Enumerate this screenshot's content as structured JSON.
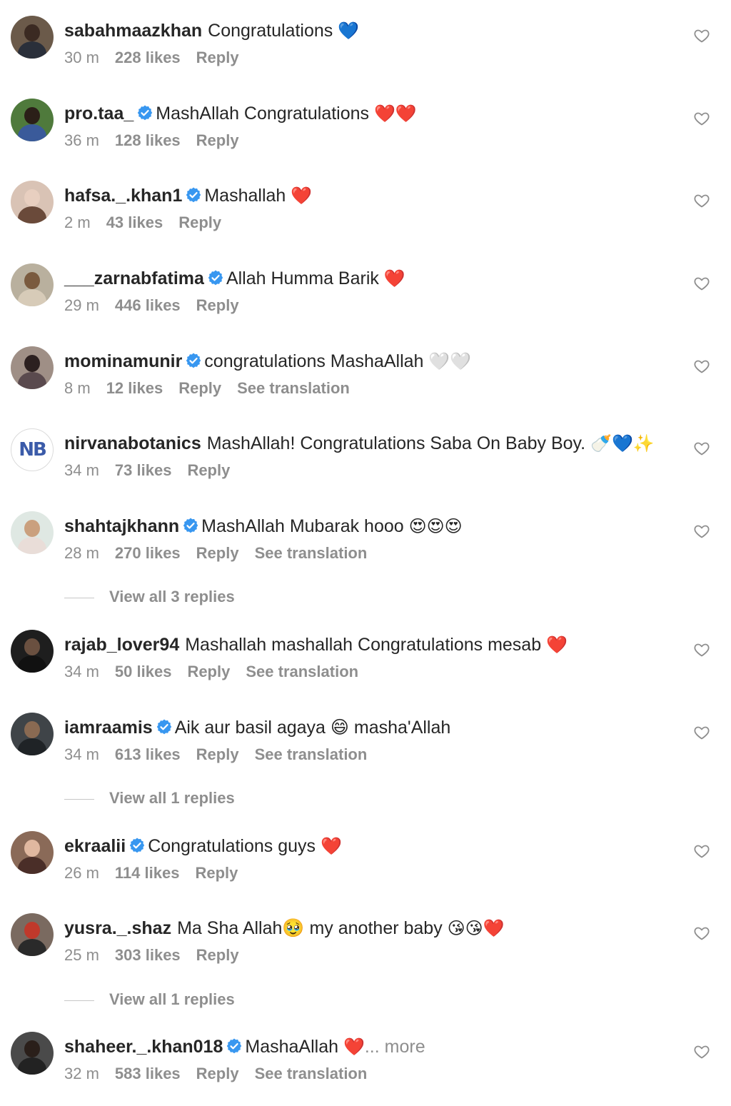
{
  "colors": {
    "text": "#262626",
    "secondary": "#8e8e8e",
    "verified": "#3897f0",
    "heart_outline": "#8e8e8e"
  },
  "comments": [
    {
      "username": "sabahmaazkhan",
      "verified": false,
      "text": "Congratulations",
      "emoji": "💙",
      "time": "30 m",
      "likes": "228 likes",
      "reply": "Reply",
      "translation": "",
      "more": ""
    },
    {
      "username": "pro.taa_",
      "verified": true,
      "text": "MashAllah Congratulations",
      "emoji": "❤️❤️",
      "time": "36 m",
      "likes": "128 likes",
      "reply": "Reply",
      "translation": "",
      "more": ""
    },
    {
      "username": "hafsa._.khan1",
      "verified": true,
      "text": "Mashallah",
      "emoji": "❤️",
      "time": "2 m",
      "likes": "43 likes",
      "reply": "Reply",
      "translation": "",
      "more": ""
    },
    {
      "username": "___zarnabfatima",
      "verified": true,
      "text": "Allah Humma Barik",
      "emoji": "❤️",
      "time": "29 m",
      "likes": "446 likes",
      "reply": "Reply",
      "translation": "",
      "more": ""
    },
    {
      "username": "mominamunir",
      "verified": true,
      "text": "congratulations MashaAllah",
      "emoji": "🤍🤍",
      "time": "8 m",
      "likes": "12 likes",
      "reply": "Reply",
      "translation": "See translation",
      "more": ""
    },
    {
      "username": "nirvanabotanics",
      "verified": false,
      "text": "MashAllah! Congratulations Saba On Baby Boy.",
      "emoji": "🍼💙✨",
      "time": "34 m",
      "likes": "73 likes",
      "reply": "Reply",
      "translation": "",
      "more": ""
    },
    {
      "username": "shahtajkhann",
      "verified": true,
      "text": "MashAllah Mubarak hooo",
      "emoji": "😍😍😍",
      "time": "28 m",
      "likes": "270 likes",
      "reply": "Reply",
      "translation": "See translation",
      "more": ""
    },
    {
      "username": "rajab_lover94",
      "verified": false,
      "text": "Mashallah mashallah Congratulations mesab",
      "emoji": "❤️",
      "time": "34 m",
      "likes": "50 likes",
      "reply": "Reply",
      "translation": "See translation",
      "more": ""
    },
    {
      "username": "iamraamis",
      "verified": true,
      "text": "Aik aur basil agaya 😄 masha'Allah",
      "emoji": "",
      "time": "34 m",
      "likes": "613 likes",
      "reply": "Reply",
      "translation": "See translation",
      "more": ""
    },
    {
      "username": "ekraalii",
      "verified": true,
      "text": "Congratulations guys",
      "emoji": "❤️",
      "time": "26 m",
      "likes": "114 likes",
      "reply": "Reply",
      "translation": "",
      "more": ""
    },
    {
      "username": "yusra._.shaz",
      "verified": false,
      "text": "Ma Sha Allah🥹 my another baby",
      "emoji": "😘😘❤️",
      "time": "25 m",
      "likes": "303 likes",
      "reply": "Reply",
      "translation": "",
      "more": ""
    },
    {
      "username": "shaheer._.khan018",
      "verified": true,
      "text": "MashaAllah",
      "emoji": "❤️",
      "time": "32 m",
      "likes": "583 likes",
      "reply": "Reply",
      "translation": "See translation",
      "more": "... more"
    }
  ],
  "view_replies": [
    {
      "after": 6,
      "label": "View all 3 replies"
    },
    {
      "after": 8,
      "label": "View all 1 replies"
    },
    {
      "after": 10,
      "label": "View all 1 replies"
    }
  ],
  "avatars": [
    {
      "bg": "#6b5a4a",
      "head": "#3b2a22",
      "body": "#2a2f3a"
    },
    {
      "bg": "#4f7a3c",
      "head": "#2b1f18",
      "body": "#3a5a9a"
    },
    {
      "bg": "#d9c3b5",
      "head": "#e8cfc0",
      "body": "#6a4a3a"
    },
    {
      "bg": "#b9b09e",
      "head": "#7a5a3e",
      "body": "#d7cbb8"
    },
    {
      "bg": "#9f8f86",
      "head": "#2c2020",
      "body": "#5a4a4e"
    },
    {
      "logo": "NB",
      "logo_color": "#3b5ba9"
    },
    {
      "bg": "#dfe8e3",
      "head": "#caa07e",
      "body": "#e9ddd8"
    },
    {
      "bg": "#1e1e1e",
      "head": "#6a5040",
      "body": "#111111"
    },
    {
      "bg": "#3f4448",
      "head": "#8a6a52",
      "body": "#1f2326"
    },
    {
      "bg": "#8a6a58",
      "head": "#e0b8a0",
      "body": "#4a2e28"
    },
    {
      "bg": "#7a6a60",
      "head": "#c0392b",
      "body": "#2a2a2a"
    },
    {
      "bg": "#4a4a4a",
      "head": "#2a1f1a",
      "body": "#222222"
    }
  ]
}
